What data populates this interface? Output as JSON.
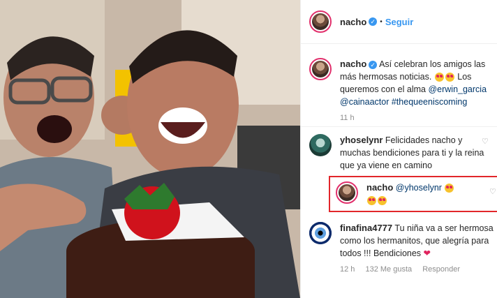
{
  "post": {
    "author": "nacho",
    "follow_label": "Seguir",
    "dot": "•",
    "caption_start": "Así celebran los amigos las más hermosas noticias.",
    "caption_mid": "Los queremos con el alma",
    "mention_1": "@erwin_garcia",
    "mention_2": "@cainaactor",
    "hashtag": "#thequeeniscoming",
    "time": "11 h"
  },
  "comments": [
    {
      "user": "yhoselynr",
      "text": "Felicidades nacho y muchas bendiciones para ti y la reina que ya viene en camino"
    },
    {
      "user": "nacho",
      "mention": "@yhoselynr"
    },
    {
      "user": "finafina4777",
      "text": "Tu niña va a ser hermosa como los hermanitos, que alegría para todos !!! Bendiciones",
      "time": "12 h",
      "likes": "132 Me gusta",
      "reply_label": "Responder"
    }
  ],
  "colors": {
    "accent": "#3897f0",
    "highlight_box": "#e2262a",
    "heart": "#e0245e"
  },
  "icons": [
    "verified-icon",
    "heart-outline-icon",
    "heart-eyes-emoji",
    "red-heart-emoji"
  ]
}
